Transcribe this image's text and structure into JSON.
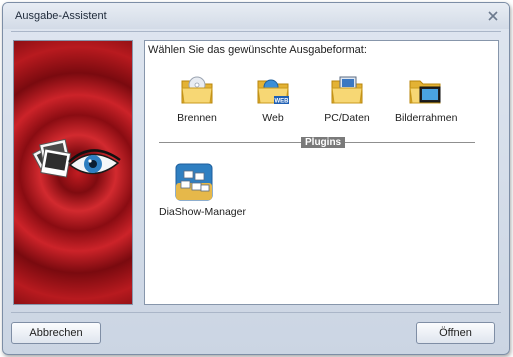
{
  "window": {
    "title": "Ausgabe-Assistent"
  },
  "prompt": "Wählen Sie das gewünschte Ausgabeformat:",
  "formats": [
    {
      "label": "Brennen",
      "icon": "folder-cd-icon"
    },
    {
      "label": "Web",
      "icon": "folder-web-icon",
      "badge": "WEB"
    },
    {
      "label": "PC/Daten",
      "icon": "folder-pc-icon"
    },
    {
      "label": "Bilderrahmen",
      "icon": "folder-frame-icon"
    }
  ],
  "section_label": "Plugins",
  "plugins": [
    {
      "label": "DiaShow-Manager",
      "icon": "slideshow-manager-icon"
    }
  ],
  "buttons": {
    "cancel": "Abbrechen",
    "open": "Öffnen"
  },
  "colors": {
    "banner_red": "#c31c21",
    "folder_yellow": "#f2c94c",
    "eye_blue": "#2f7fc1"
  }
}
